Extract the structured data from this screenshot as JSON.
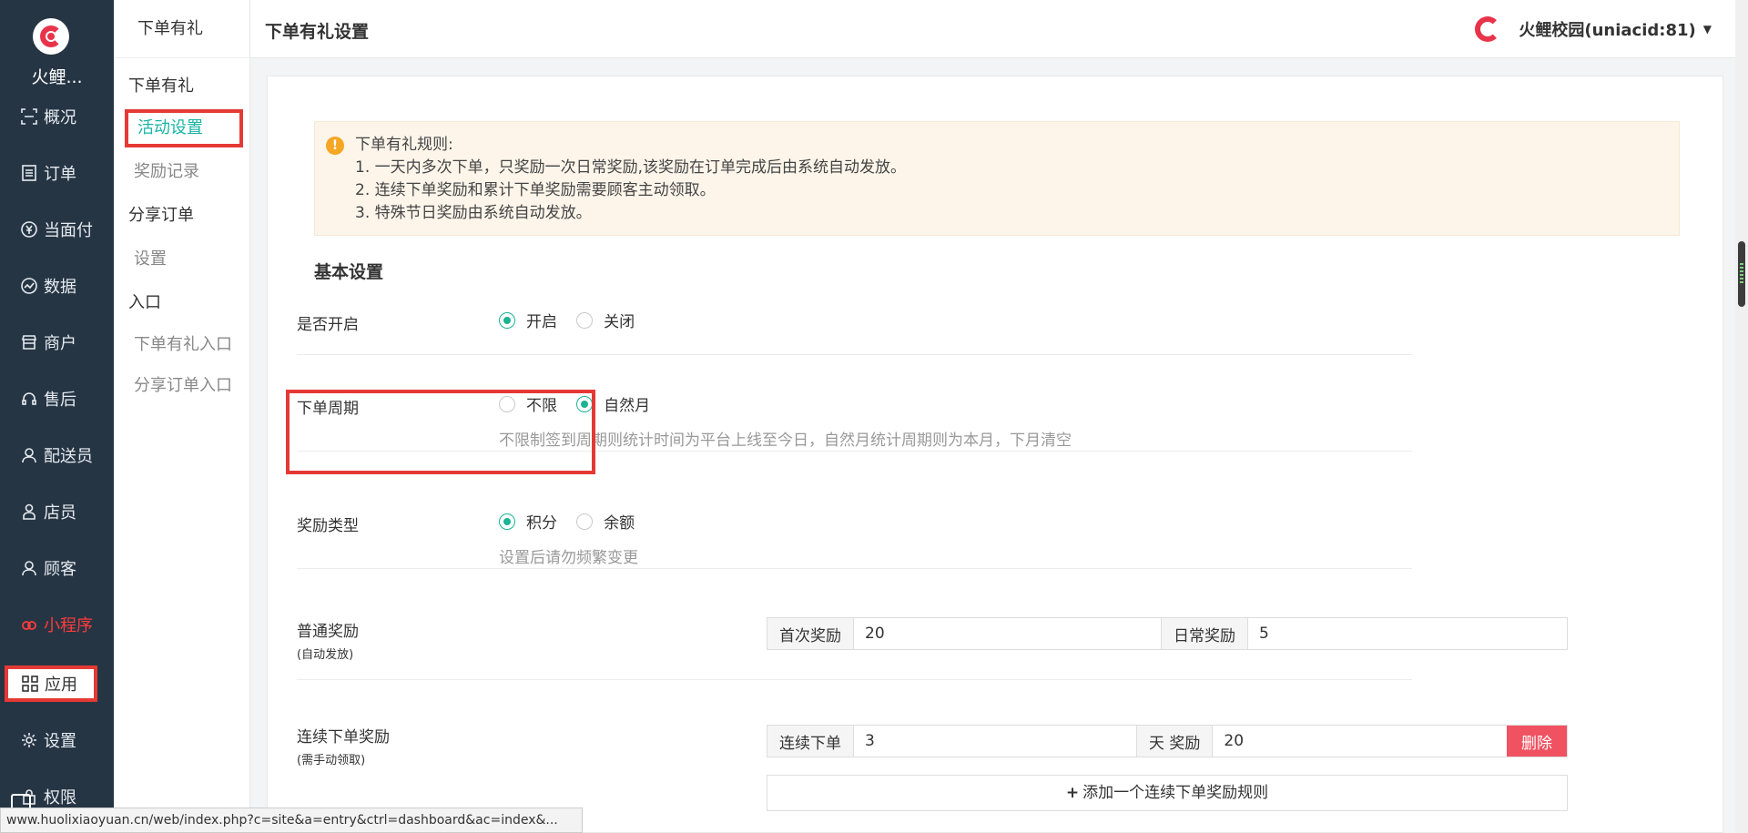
{
  "nav": {
    "brand": "火鲤...",
    "items": [
      {
        "label": "概况",
        "icon": "scan-icon"
      },
      {
        "label": "订单",
        "icon": "order-icon"
      },
      {
        "label": "当面付",
        "icon": "yuan-icon"
      },
      {
        "label": "数据",
        "icon": "chart-icon"
      },
      {
        "label": "商户",
        "icon": "store-icon"
      },
      {
        "label": "售后",
        "icon": "headset-icon"
      },
      {
        "label": "配送员",
        "icon": "user-icon"
      },
      {
        "label": "店员",
        "icon": "person-icon"
      },
      {
        "label": "顾客",
        "icon": "customer-icon"
      },
      {
        "label": "小程序",
        "icon": "miniapp-icon"
      },
      {
        "label": "应用",
        "icon": "apps-icon"
      },
      {
        "label": "设置",
        "icon": "gear-icon"
      },
      {
        "label": "权限",
        "icon": "lock-icon"
      }
    ]
  },
  "subnav": {
    "head": "下单有礼",
    "group1": "下单有礼",
    "link_activity": "活动设置",
    "link_records": "奖励记录",
    "group2": "分享订单",
    "link_settings": "设置",
    "group3": "入口",
    "link_entry1": "下单有礼入口",
    "link_entry2": "分享订单入口"
  },
  "topbar": {
    "title": "下单有礼设置",
    "user": "火鲤校园(uniacid:81)"
  },
  "notice": {
    "title": "下单有礼规则:",
    "lines": [
      "1. 一天内多次下单，只奖励一次日常奖励,该奖励在订单完成后由系统自动发放。",
      "2. 连续下单奖励和累计下单奖励需要顾客主动领取。",
      "3. 特殊节日奖励由系统自动发放。"
    ]
  },
  "form": {
    "section_title": "基本设置",
    "enable": {
      "label": "是否开启",
      "on": "开启",
      "off": "关闭",
      "selected": "开启"
    },
    "cycle": {
      "label": "下单周期",
      "opt1": "不限",
      "opt2": "自然月",
      "selected": "自然月",
      "hint": "不限制签到周期则统计时间为平台上线至今日，自然月统计周期则为本月，下月清空"
    },
    "reward_type": {
      "label": "奖励类型",
      "opt1": "积分",
      "opt2": "余额",
      "selected": "积分",
      "hint": "设置后请勿频繁变更"
    },
    "normal": {
      "label": "普通奖励",
      "sub": "(自动发放)",
      "first_label": "首次奖励",
      "first_value": "20",
      "daily_label": "日常奖励",
      "daily_value": "5"
    },
    "streak": {
      "label": "连续下单奖励",
      "sub": "(需手动领取)",
      "days_label": "连续下单",
      "days_value": "3",
      "reward_label": "天 奖励",
      "reward_value": "20",
      "delete": "删除",
      "add": "添加一个连续下单奖励规则"
    }
  },
  "statusbar": "www.huolixiaoyuan.cn/web/index.php?c=site&a=entry&ctrl=dashboard&ac=index&..."
}
